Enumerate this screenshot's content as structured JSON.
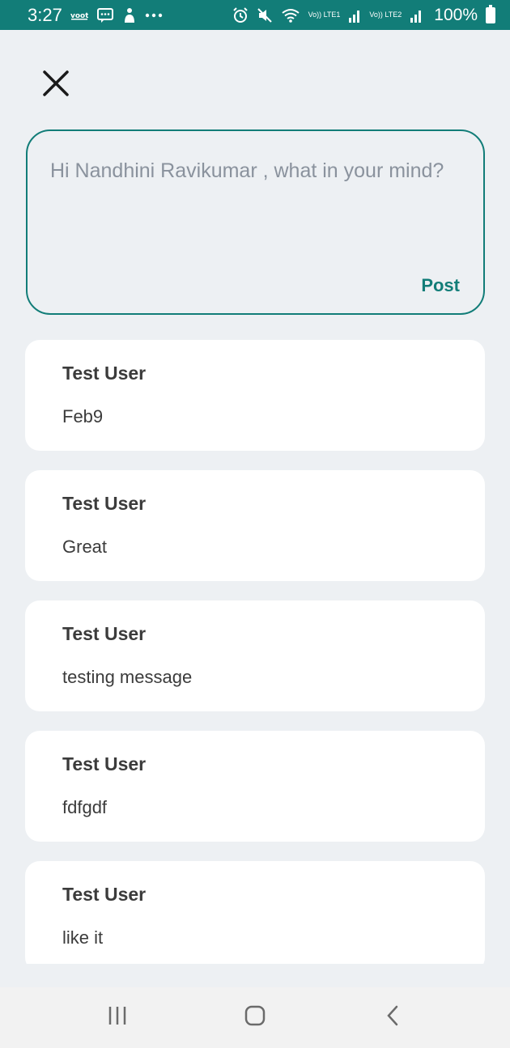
{
  "status_bar": {
    "time": "3:27",
    "notification_icons": [
      "voot-icon",
      "chat-icon",
      "hand-icon",
      "more-icon"
    ],
    "battery": "100%",
    "network_label_1": "Vo)) LTE1",
    "network_label_2": "Vo)) LTE2"
  },
  "compose": {
    "placeholder": "Hi Nandhini Ravikumar , what in your mind?",
    "post_label": "Post"
  },
  "feed": {
    "posts": [
      {
        "user": "Test User",
        "message": "Feb9"
      },
      {
        "user": "Test User",
        "message": "Great"
      },
      {
        "user": "Test User",
        "message": "testing message"
      },
      {
        "user": "Test User",
        "message": "fdfgdf"
      },
      {
        "user": "Test User",
        "message": "like it"
      }
    ]
  },
  "colors": {
    "accent": "#127d78",
    "background": "#edf0f3",
    "card": "#ffffff",
    "text": "#3b3b3b",
    "placeholder": "#8a929d"
  }
}
